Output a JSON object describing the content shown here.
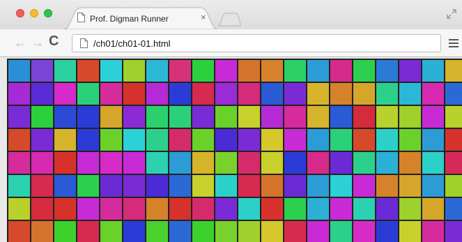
{
  "browser": {
    "tab_title": "Prof. Digman Runner",
    "tab_close": "×",
    "url": "/ch01/ch01-01.html",
    "nav_back": "←",
    "nav_forward": "→",
    "nav_reload": "C"
  },
  "page": {
    "grid": {
      "columns": 20,
      "rows": 8,
      "colors": [
        [
          "#2a8fd6",
          "#7a44d6",
          "#2bd1a1",
          "#d8492a",
          "#2bd1d6",
          "#9ed12b",
          "#2bb8d6",
          "#d6327a",
          "#2bd13c",
          "#c82bd6",
          "#d6732b",
          "#d6822b",
          "#2bd165",
          "#2b9cd6",
          "#d62b8a",
          "#2bd14e",
          "#2b7ad6",
          "#7a2bd6",
          "#2bb0d6",
          "#d6b42b"
        ],
        [
          "#a62bd6",
          "#5a2bd6",
          "#d62bc8",
          "#2bd17a",
          "#d62b9c",
          "#d6322b",
          "#b42bd6",
          "#2b3cd6",
          "#d62b4e",
          "#9a2bd6",
          "#d62b7a",
          "#2b5ad6",
          "#7a2bd6",
          "#d6b42b",
          "#d6822b",
          "#d6a62b",
          "#2bd18a",
          "#2bb8d6",
          "#d62bb0",
          "#2b6ad6"
        ],
        [
          "#7a2bd6",
          "#2bd13c",
          "#2b4ad6",
          "#2b3cd6",
          "#d6a62b",
          "#8a2bd6",
          "#2bd16a",
          "#2bd17a",
          "#7a2bd6",
          "#6ad12b",
          "#c8d12b",
          "#b42bd6",
          "#d62b9c",
          "#d6b42b",
          "#2b5ad6",
          "#d62b3c",
          "#b8d12b",
          "#9ed12b",
          "#c82bd6",
          "#b8d12b"
        ],
        [
          "#d6492b",
          "#7a2bd6",
          "#d6b42b",
          "#2b3cd6",
          "#6ad12b",
          "#2bd1d6",
          "#2bd18a",
          "#d62b6a",
          "#6ad12b",
          "#4a2bd6",
          "#7a2bd6",
          "#d6c82b",
          "#c82bd6",
          "#2b9cd6",
          "#2bd17a",
          "#d64a2b",
          "#2bd1c8",
          "#6ad12b",
          "#2b9cd6",
          "#d6322b"
        ],
        [
          "#d62b9c",
          "#d62bb0",
          "#d6322b",
          "#c82bd6",
          "#d62bc8",
          "#c82bd6",
          "#2bd1b0",
          "#2b9cd6",
          "#d6b42b",
          "#7ad12b",
          "#d62b6a",
          "#c8d12b",
          "#2b3cd6",
          "#d62b8a",
          "#6a2bd6",
          "#2bd18a",
          "#2bb0d6",
          "#d6822b",
          "#2bd1c8",
          "#d62b5a"
        ],
        [
          "#2bd1b0",
          "#d62b4e",
          "#2b5ad6",
          "#2bd14e",
          "#6a2bd6",
          "#7a2bd6",
          "#4a2bd6",
          "#2b6ad6",
          "#c8d12b",
          "#2bd1c8",
          "#d62b4e",
          "#d6732b",
          "#6a2bd6",
          "#2b9cd6",
          "#2bd1d6",
          "#c82bd6",
          "#d6822b",
          "#d6a62b",
          "#2b9cd6",
          "#9ed12b"
        ],
        [
          "#b8d12b",
          "#d62b3c",
          "#d6322b",
          "#c82bd6",
          "#d62b9c",
          "#d62b7a",
          "#d6822b",
          "#d6322b",
          "#d62b6a",
          "#7a2bd6",
          "#2bd1c8",
          "#d6322b",
          "#2bd14e",
          "#2bb0d6",
          "#c82bd6",
          "#2bd1b0",
          "#6a2bd6",
          "#9ed12b",
          "#d6a62b",
          "#2b6ad6"
        ],
        [
          "#d6492b",
          "#d6732b",
          "#3cd12b",
          "#d62b4e",
          "#6ad12b",
          "#2b3cd6",
          "#4ad12b",
          "#2b6ad6",
          "#3cd12b",
          "#7ad12b",
          "#9ed12b",
          "#d6c82b",
          "#d62b4e",
          "#c82bd6",
          "#2bd18a",
          "#d62bc8",
          "#2b3cd6",
          "#c8d12b",
          "#d62b9c",
          "#7a2bd6"
        ]
      ]
    }
  }
}
